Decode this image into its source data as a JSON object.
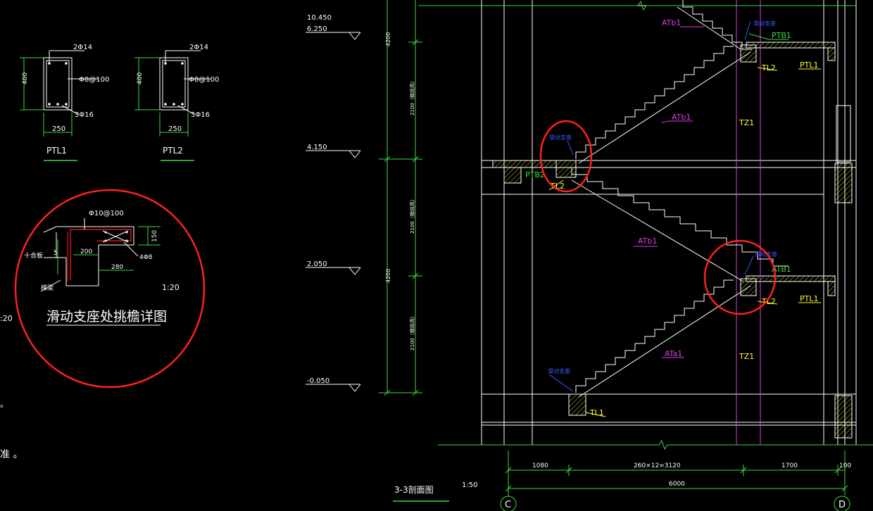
{
  "colors": {
    "background": "#000000",
    "white": "#ffffff",
    "green": "#3ddc3d",
    "yellow": "#ffff33",
    "magenta": "#e040e0",
    "blue": "#3b5cff",
    "red": "#ff2020",
    "gray": "#c8c8c8"
  },
  "beams": {
    "ptl1": {
      "top_rebar": "2Φ14",
      "stirrup": "Φ8@100",
      "bottom_rebar": "3Φ16",
      "height": "400",
      "width": "250",
      "name": "PTL1"
    },
    "ptl2": {
      "top_rebar": "2Φ14",
      "stirrup": "Φ8@100",
      "bottom_rebar": "3Φ16",
      "height": "400",
      "width": "250",
      "name": "PTL2"
    }
  },
  "detail": {
    "title": "滑动支座处挑檐详图",
    "rebar_top": "Φ10@100",
    "rebar_side": "4Φ8",
    "dim_200": "200",
    "dim_280": "280",
    "dim_150": "150",
    "dim_5": "5",
    "label_left": "十合板",
    "label_bottom": "梯梁",
    "scale": "1:20",
    "left_scale": ":20"
  },
  "side_marks": {
    "mark1": "。",
    "mark2": "准 。"
  },
  "elevations": {
    "e1": "10.450",
    "e2": "6.250",
    "e3": "4.150",
    "e4": "2.050",
    "e5": "-0.050"
  },
  "vertical_dims": {
    "d1": "4200",
    "d2": "2100（梯段高）",
    "d3": "2100（梯段高）",
    "d4": "4200",
    "d5": "2100（梯段高）"
  },
  "section": {
    "title": "3-3剖面图",
    "scale": "1:50",
    "labels": {
      "atb1_top": "ATb1",
      "atb1_mid": "ATb1",
      "atb1_low": "ATb1",
      "ata1": "ATa1",
      "ptb1_top": "PTB1",
      "ptb1_low": "ATB1",
      "ptb2": "PTB2",
      "ptl1_top": "PTL1",
      "ptl1_low": "PTL1",
      "tl2_top": "TL2",
      "tl2_mid": "TL2",
      "tl2_low": "TL2",
      "tl1": "TL1",
      "tz1_top": "TZ1",
      "tz1_low": "TZ1",
      "slide1": "滑动支座",
      "slide2": "滑动支座",
      "slide3": "滑动支座",
      "slide4": "滑动支座"
    },
    "dims": {
      "d1080": "1080",
      "d3120": "260×12=3120",
      "d1700": "1700",
      "d100": "100",
      "d6000": "6000"
    },
    "axes": {
      "c": "C",
      "d": "D"
    }
  }
}
